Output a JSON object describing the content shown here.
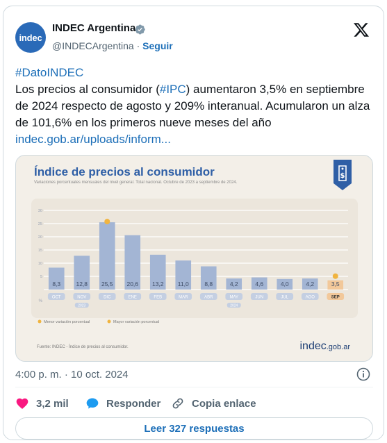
{
  "author": {
    "avatar_text": "indec",
    "name": "INDEC Argentina",
    "handle": "@INDECArgentina",
    "separator": "·",
    "follow_label": "Seguir"
  },
  "tweet": {
    "hashtag": "#DatoINDEC",
    "line_prefix": "Los precios al consumidor (",
    "ipc_tag": "#IPC",
    "line_rest": ") aumentaron 3,5% en septiembre de 2024 respecto de agosto y 209% interanual. Acumularon un alza de 101,6% en los primeros nueve meses del año ",
    "link": "indec.gob.ar/uploads/inform..."
  },
  "infographic": {
    "title": "Índice de precios al consumidor",
    "subtitle": "Variaciones porcentuales mensuales del nivel general. Total nacional. Octubre de 2023 a septiembre de 2024.",
    "source": "Fuente: INDEC - Índice de precios al consumidor.",
    "brand": "indec",
    "brand_suffix": ".gob.ar",
    "legend_min": "Menor variación porcentual",
    "legend_max": "Mayor variación porcentual",
    "year_2023": "2023",
    "year_2024": "2024",
    "colors": {
      "bar": "#a3b5d4",
      "highlight": "#f2c89a",
      "dot": "#f0b440",
      "title": "#2f5fa6"
    }
  },
  "chart_data": {
    "type": "bar",
    "title": "Índice de precios al consumidor",
    "categories": [
      "OCT",
      "NOV",
      "DIC",
      "ENE",
      "FEB",
      "MAR",
      "ABR",
      "MAY",
      "JUN",
      "JUL",
      "AGO",
      "SEP"
    ],
    "values": [
      8.3,
      12.8,
      25.5,
      20.6,
      13.2,
      11.0,
      8.8,
      4.2,
      4.6,
      4.0,
      4.2,
      3.5
    ],
    "labels": [
      "8,3",
      "12,8",
      "25,5",
      "20,6",
      "13,2",
      "11,0",
      "8,8",
      "4,2",
      "4,6",
      "4,0",
      "4,2",
      "3,5"
    ],
    "yticks": [
      5,
      10,
      15,
      20,
      25,
      30
    ],
    "yunit": "%",
    "ylim": [
      0,
      30
    ],
    "grid": true,
    "max_index": 2,
    "min_index": 11
  },
  "meta": {
    "timestamp": "4:00 p. m. · 10 oct. 2024"
  },
  "actions": {
    "likes": "3,2 mil",
    "reply": "Responder",
    "copy_link": "Copia enlace",
    "read_replies": "Leer 327 respuestas"
  }
}
